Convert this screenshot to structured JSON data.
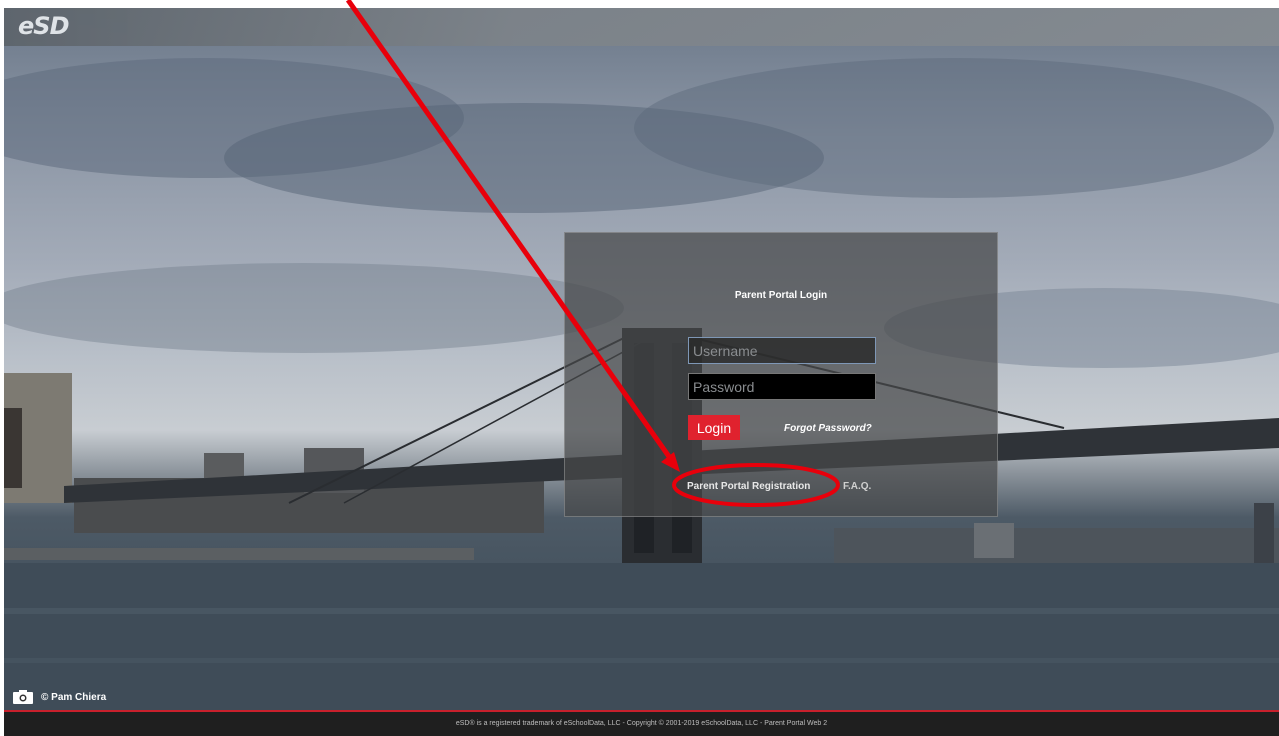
{
  "header": {
    "logo": "eSD"
  },
  "login": {
    "title": "Parent Portal Login",
    "username_placeholder": "Username",
    "password_placeholder": "Password",
    "login_label": "Login",
    "forgot_label": "Forgot Password?",
    "register_label": "Parent Portal Registration",
    "faq_label": "F.A.Q."
  },
  "credit": {
    "text": "© Pam Chiera"
  },
  "footer": {
    "text": "eSD® is a registered trademark of eSchoolData, LLC - Copyright © 2001-2019 eSchoolData, LLC - Parent Portal Web 2"
  },
  "colors": {
    "accent": "#e0222e",
    "annotation": "#e8000b",
    "footer_bg": "#1f1f1f"
  }
}
